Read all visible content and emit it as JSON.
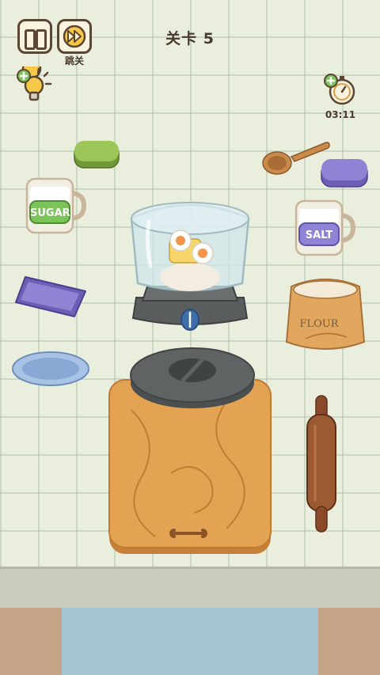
{
  "hud": {
    "level_title": "关卡 5",
    "skip_label": "跳关",
    "timer": "03:11"
  },
  "jars": {
    "sugar_label": "SUGAR",
    "salt_label": "SALT",
    "flour_label": "FLOUR"
  },
  "icons": {
    "pause": "pause-icon",
    "skip": "fast-forward-icon",
    "hint": "lightbulb-icon",
    "timer": "stopwatch-icon"
  },
  "colors": {
    "wall": "#e9eedd",
    "outline": "#5a4633",
    "green_lid": "#8fbc4a",
    "purple_lid": "#8a7ed0",
    "wood": "#d9984a"
  }
}
